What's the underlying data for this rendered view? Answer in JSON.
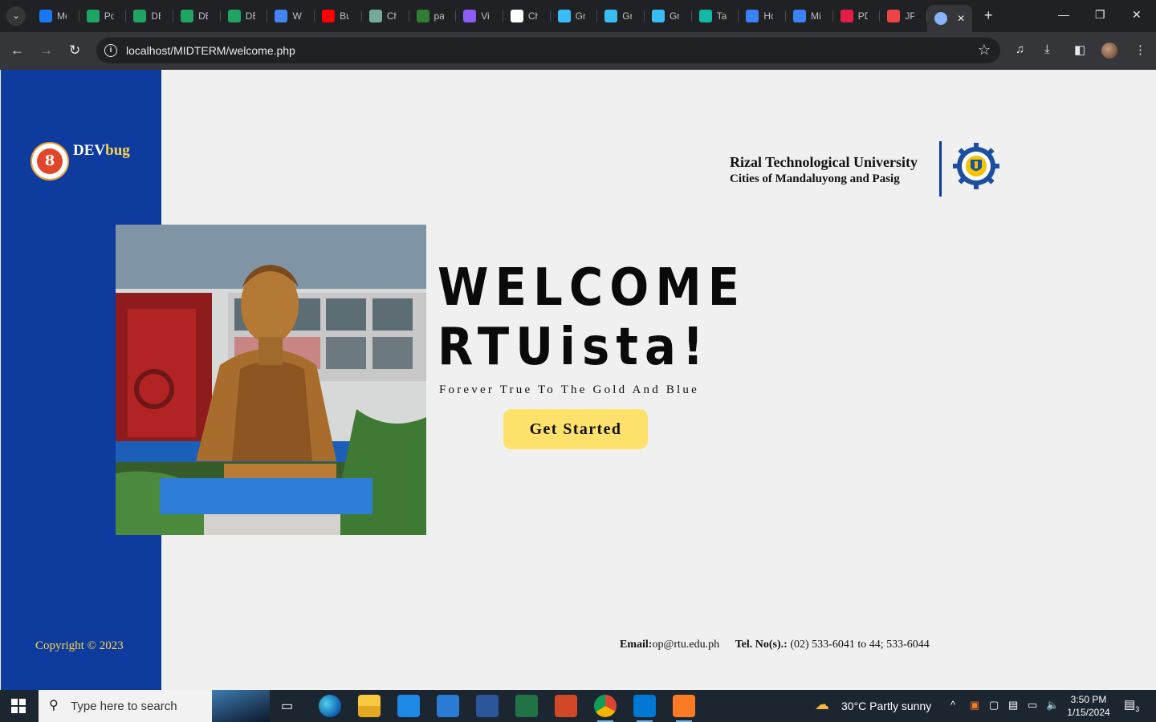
{
  "browser": {
    "tabs": [
      {
        "label": "Me",
        "color": "#1877f2"
      },
      {
        "label": "Po",
        "color": "#1fa463"
      },
      {
        "label": "DE",
        "color": "#1fa463"
      },
      {
        "label": "DE",
        "color": "#1fa463"
      },
      {
        "label": "DE",
        "color": "#1fa463"
      },
      {
        "label": "Wi",
        "color": "#4285f4"
      },
      {
        "label": "Bu",
        "color": "#ff0000"
      },
      {
        "label": "Ch",
        "color": "#74aa9c"
      },
      {
        "label": "pa",
        "color": "#2f7d32"
      },
      {
        "label": "Vi",
        "color": "#8b5cf6"
      },
      {
        "label": "Ch",
        "color": "#ffffff"
      },
      {
        "label": "Gr",
        "color": "#38bdf8"
      },
      {
        "label": "Gr",
        "color": "#38bdf8"
      },
      {
        "label": "Gr",
        "color": "#38bdf8"
      },
      {
        "label": "Ta",
        "color": "#14b8a6"
      },
      {
        "label": "Ho",
        "color": "#3b82f6"
      },
      {
        "label": "Mi",
        "color": "#3b82f6"
      },
      {
        "label": "PD",
        "color": "#e11d48"
      },
      {
        "label": "JP",
        "color": "#ef4444"
      }
    ],
    "active_tab_icon": "globe-icon",
    "url": "localhost/MIDTERM/welcome.php"
  },
  "page": {
    "brand": {
      "main": "DEV",
      "accent": "bug",
      "logo_text": "8"
    },
    "university": {
      "name": "Rizal Technological University",
      "sub": "Cities of Mandaluyong and Pasig"
    },
    "hero": {
      "line1": "WELCOME",
      "line2": "RTUista!",
      "tagline": "Forever True To The Gold And Blue",
      "cta": "Get Started"
    },
    "footer": {
      "copyright": "Copyright © 2023",
      "email_label": "Email:",
      "email": "op@rtu.edu.ph",
      "tel_label": "Tel. No(s).:",
      "tel": "(02) 533-6041 to 44; 533-6044"
    },
    "colors": {
      "sidebar": "#0d3b9e",
      "accent_yellow": "#f9d44c",
      "cta": "#fde16a"
    }
  },
  "taskbar": {
    "search_placeholder": "Type here to search",
    "weather": "30°C  Partly sunny",
    "time": "3:50 PM",
    "date": "1/15/2024",
    "notifications": "3"
  }
}
